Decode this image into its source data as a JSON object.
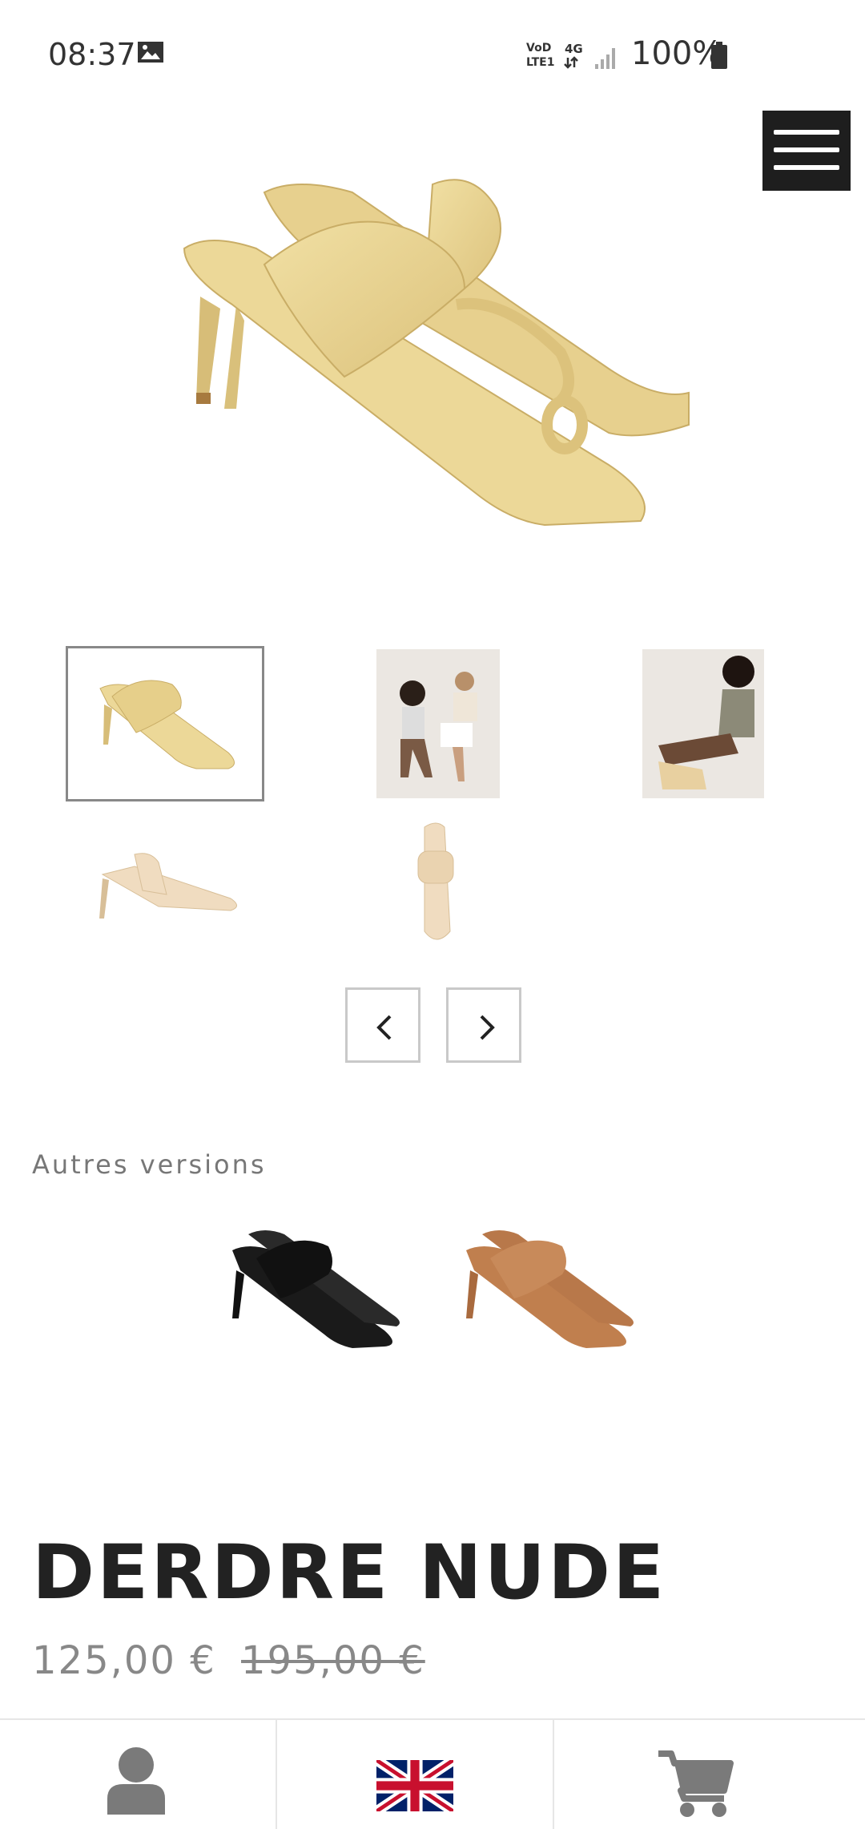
{
  "status_bar": {
    "time": "08:37",
    "network_label_top": "VoD",
    "network_label_bottom": "LTE1",
    "network_type": "4G",
    "battery": "100%"
  },
  "menu": {
    "icon": "hamburger-menu-icon"
  },
  "gallery": {
    "main_alt": "Derdre Nude sandals",
    "prev_icon": "chevron-left-icon",
    "next_icon": "chevron-right-icon"
  },
  "versions": {
    "title": "Autres versions",
    "items": [
      {
        "color": "#1a1a1a"
      },
      {
        "color": "#b8784a"
      }
    ]
  },
  "product": {
    "title": "DERDRE NUDE",
    "price_current": "125,00 €",
    "price_old": "195,00 €",
    "shoe_color": "#e9d491"
  },
  "bottom_nav": {
    "account_icon": "user-icon",
    "language_icon": "uk-flag-icon",
    "cart_icon": "cart-icon"
  }
}
